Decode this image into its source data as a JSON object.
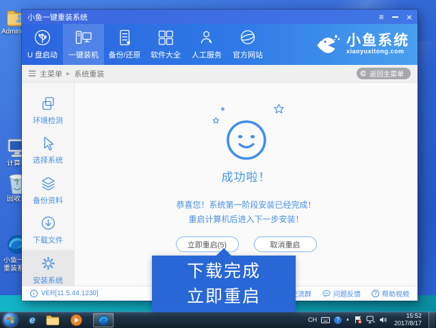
{
  "colors": {
    "accent": "#2f6ad9",
    "callout": "#2867d5",
    "link_blue": "#4a90e2",
    "teal": "#0fa8bc"
  },
  "desktop": {
    "icons": [
      {
        "label": "Administrator"
      },
      {
        "label": "计算机"
      },
      {
        "label": "回收站"
      },
      {
        "label": "小鱼一键重装系统"
      }
    ]
  },
  "window": {
    "title": "小鱼一键重装系统",
    "controls": {
      "menu": "≡",
      "close": "×"
    },
    "nav": {
      "items": [
        {
          "label": "U 盘启动"
        },
        {
          "label": "一键装机"
        },
        {
          "label": "备份/还原"
        },
        {
          "label": "软件大全"
        },
        {
          "label": "人工服务"
        },
        {
          "label": "官方网站"
        }
      ],
      "brand": {
        "name": "小鱼系统",
        "domain": "xiaoyuxitong.com"
      }
    },
    "breadcrumb": {
      "root": "主菜单",
      "separator": "▶",
      "current": "系统重装",
      "back_label": "返回主菜单"
    },
    "sidebar": {
      "items": [
        {
          "label": "环境检测"
        },
        {
          "label": "选择系统"
        },
        {
          "label": "备份资料"
        },
        {
          "label": "下载文件"
        },
        {
          "label": "安装系统"
        }
      ]
    },
    "main": {
      "success_title": "成功啦！",
      "message_line1": "恭喜您！系统第一阶段安装已经完成！",
      "message_line2": "重启计算机后进入下一步安装！",
      "restart_button": "立即重启(5)",
      "cancel_button": "取消重启"
    },
    "footer": {
      "info_glyph": "i",
      "version": "VER[11.5.44.1230]",
      "links": [
        {
          "label": "交流群"
        },
        {
          "label": "问题反馈"
        },
        {
          "label": "帮助视频"
        }
      ],
      "help_glyph": "?"
    }
  },
  "callout": {
    "line1": "下载完成",
    "line2": "立即重启"
  },
  "taskbar": {
    "ie_glyph": "e",
    "lang": "CH",
    "help_glyph": "?",
    "expand_glyph": "▲",
    "time": "15:52",
    "date": "2017/8/17"
  }
}
